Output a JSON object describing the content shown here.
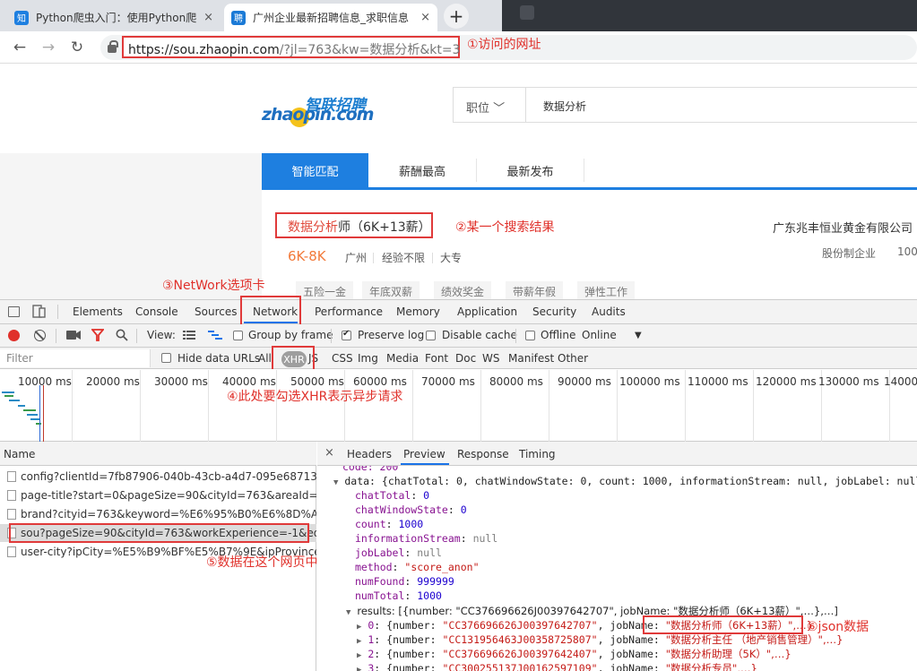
{
  "browser": {
    "tabs": [
      {
        "favicon": "知",
        "title": "Python爬虫入门：使用Python爬",
        "close": "×"
      },
      {
        "favicon": "聘",
        "title": "广州企业最新招聘信息_求职信息",
        "close": "×"
      }
    ],
    "new_tab": "+",
    "url_host": "https://sou.zhaopin.com",
    "url_path": "/?jl=763&kw=数据分析&kt=3"
  },
  "page": {
    "logo_cn": "智联招聘",
    "logo_en": "zhaopin.com",
    "search_select": "职位 ﹀",
    "search_value": "数据分析",
    "nav_tabs": [
      "智能匹配",
      "薪酬最高",
      "最新发布"
    ],
    "job_title_keyword": "数据分析",
    "job_title_rest": "师（6K+13薪）",
    "company": "广东兆丰恒业黄金有限公司",
    "salary": "6K-8K",
    "meta": [
      "广州",
      "经验不限",
      "大专"
    ],
    "company_type": "股份制企业",
    "company_size": "100",
    "tags": [
      "五险一金",
      "年底双薪",
      "绩效奖金",
      "带薪年假",
      "弹性工作"
    ]
  },
  "annotations": {
    "a1": "①访问的网址",
    "a2": "②某一个搜索结果",
    "a3": "③NetWork选项卡",
    "a4": "④此处要勾选XHR表示异步请求",
    "a5": "⑤数据在这个网页中",
    "a6": "⑥json数据"
  },
  "devtools": {
    "tabs": [
      "Elements",
      "Console",
      "Sources",
      "Network",
      "Performance",
      "Memory",
      "Application",
      "Security",
      "Audits"
    ],
    "active_tab": "Network",
    "controls": {
      "view_label": "View:",
      "group_by_frame": "Group by frame",
      "preserve_log": "Preserve log",
      "disable_cache": "Disable cache",
      "offline": "Offline",
      "throttle": "Online"
    },
    "filter": {
      "placeholder": "Filter",
      "hide_data_urls": "Hide data URLs",
      "all": "All",
      "types": [
        "XHR",
        "JS",
        "CSS",
        "Img",
        "Media",
        "Font",
        "Doc",
        "WS",
        "Manifest",
        "Other"
      ]
    },
    "timeline_ticks": [
      "10000 ms",
      "20000 ms",
      "30000 ms",
      "40000 ms",
      "50000 ms",
      "60000 ms",
      "70000 ms",
      "80000 ms",
      "90000 ms",
      "100000 ms",
      "110000 ms",
      "120000 ms",
      "130000 ms",
      "140000"
    ],
    "request_header": "Name",
    "requests": [
      "config?clientId=7fb87906-040b-43cb-a4d7-095e68713a...tp...",
      "page-title?start=0&pageSize=90&cityId=763&areaId=&...V...",
      "brand?cityid=763&keyword=%E6%95%B0%E6%8D%AE%E5...",
      "sou?pageSize=90&cityId=763&workExperience=-1&educa...",
      "user-city?ipCity=%E5%B9%BF%E5%B7%9E&ipProvince=%E..."
    ],
    "detail_close": "×",
    "detail_tabs": [
      "Headers",
      "Preview",
      "Response",
      "Timing"
    ],
    "active_detail_tab": "Preview",
    "json": {
      "code_line": "code: 200",
      "data_line": "data: {chatTotal: 0, chatWindowState: 0, count: 1000, informationStream: null, jobLabel: null,…}",
      "fields": [
        {
          "key": "chatTotal",
          "value": "0",
          "kind": "n"
        },
        {
          "key": "chatWindowState",
          "value": "0",
          "kind": "n"
        },
        {
          "key": "count",
          "value": "1000",
          "kind": "n"
        },
        {
          "key": "informationStream",
          "value": "null",
          "kind": "g"
        },
        {
          "key": "jobLabel",
          "value": "null",
          "kind": "g"
        },
        {
          "key": "method",
          "value": "\"score_anon\"",
          "kind": "s"
        },
        {
          "key": "numFound",
          "value": "999999",
          "kind": "n"
        },
        {
          "key": "numTotal",
          "value": "1000",
          "kind": "n"
        }
      ],
      "results_line": "results: [{number: \"CC376696626J00397642707\", jobName: \"数据分析师（6K+13薪）\",…},…]",
      "results": [
        {
          "index": "0",
          "number": "\"CC376696626J00397642707\"",
          "jobName": "\"数据分析师（6K+13薪）\",…}"
        },
        {
          "index": "1",
          "number": "\"CC131956463J00358725807\"",
          "jobName": "\"数据分析主任 （地产销售管理）\",…}"
        },
        {
          "index": "2",
          "number": "\"CC376696626J00397642407\"",
          "jobName": "\"数据分析助理（5K）\",…}"
        },
        {
          "index": "3",
          "number": "\"CC300255137J00162597109\"",
          "jobName": "\"数据分析专员\",…}"
        }
      ]
    }
  }
}
